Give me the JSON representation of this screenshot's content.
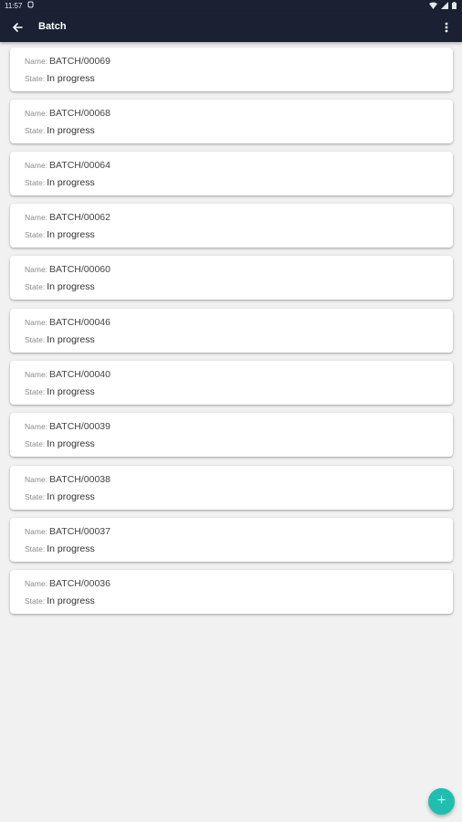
{
  "status_bar": {
    "time": "11:57"
  },
  "app_bar": {
    "title": "Batch"
  },
  "batches": [
    {
      "name_label": "Name:",
      "name": "BATCH/00069",
      "state_label": "State:",
      "state": "In progress"
    },
    {
      "name_label": "Name:",
      "name": "BATCH/00068",
      "state_label": "State:",
      "state": "In progress"
    },
    {
      "name_label": "Name:",
      "name": "BATCH/00064",
      "state_label": "State:",
      "state": "In progress"
    },
    {
      "name_label": "Name:",
      "name": "BATCH/00062",
      "state_label": "State:",
      "state": "In progress"
    },
    {
      "name_label": "Name:",
      "name": "BATCH/00060",
      "state_label": "State:",
      "state": "In progress"
    },
    {
      "name_label": "Name:",
      "name": "BATCH/00046",
      "state_label": "State:",
      "state": "In progress"
    },
    {
      "name_label": "Name:",
      "name": "BATCH/00040",
      "state_label": "State:",
      "state": "In progress"
    },
    {
      "name_label": "Name:",
      "name": "BATCH/00039",
      "state_label": "State:",
      "state": "In progress"
    },
    {
      "name_label": "Name:",
      "name": "BATCH/00038",
      "state_label": "State:",
      "state": "In progress"
    },
    {
      "name_label": "Name:",
      "name": "BATCH/00037",
      "state_label": "State:",
      "state": "In progress"
    },
    {
      "name_label": "Name:",
      "name": "BATCH/00036",
      "state_label": "State:",
      "state": "In progress"
    }
  ],
  "fab": {
    "icon": "plus-icon",
    "label": "+"
  },
  "colors": {
    "app_bar": "#1b2133",
    "background": "#f1f1f1",
    "card": "#ffffff",
    "fab": "#1ebfb0"
  }
}
